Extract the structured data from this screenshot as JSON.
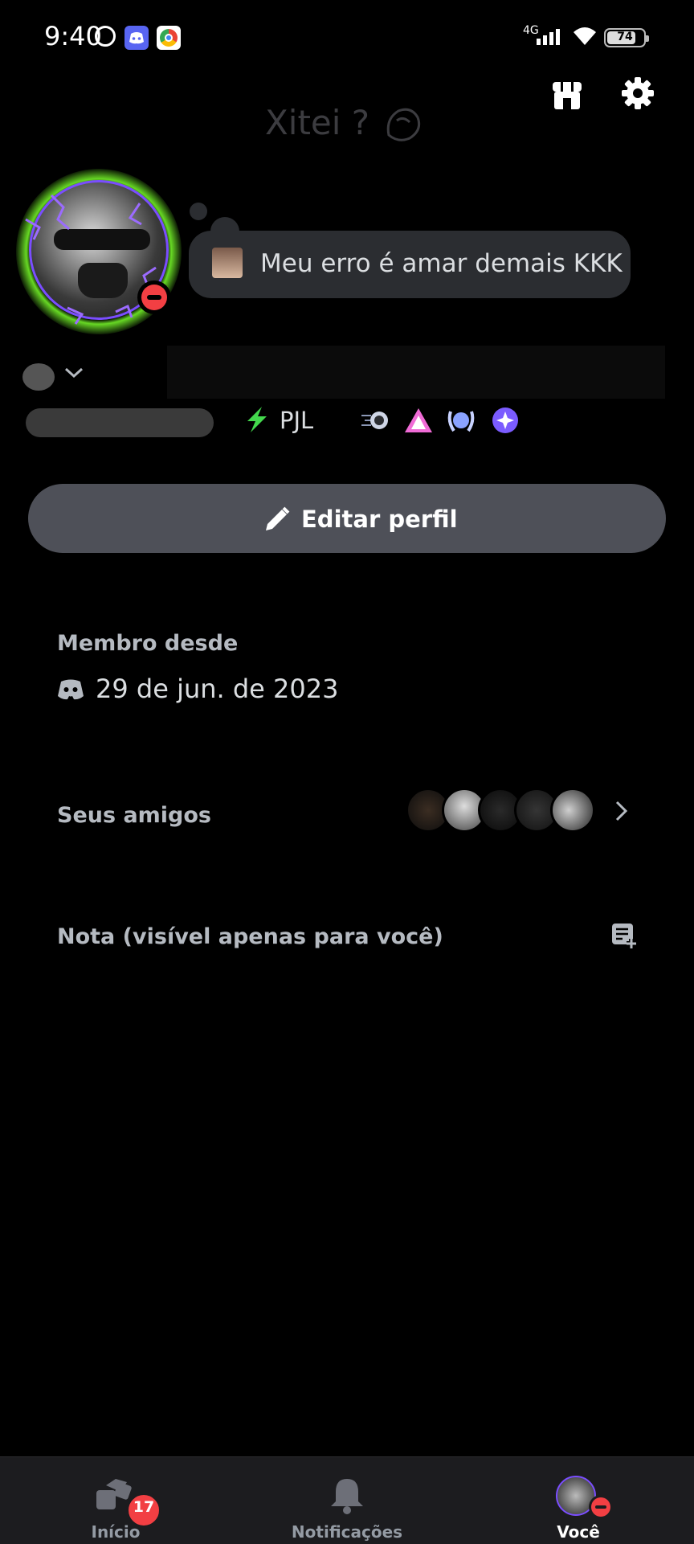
{
  "status_bar": {
    "time": "9:40",
    "network": "4G",
    "battery": "74",
    "icons": [
      "alarm-icon",
      "discord-icon",
      "chrome-icon",
      "signal-icon",
      "wifi-icon",
      "battery-icon"
    ]
  },
  "header": {
    "title": "Xitei ?",
    "icons": [
      "shop-icon",
      "gear-icon"
    ]
  },
  "profile": {
    "status_message": "Meu erro é amar demais KKK",
    "server_tag": "PJL",
    "badges": [
      "speed-badge-icon",
      "triangle-badge-icon",
      "laurel-badge-icon",
      "nitro-badge-icon"
    ],
    "status": "do-not-disturb"
  },
  "actions": {
    "edit_profile": "Editar perfil"
  },
  "info": {
    "member_since_label": "Membro desde",
    "member_since_date": "29 de jun. de 2023",
    "friends_label": "Seus amigos",
    "note_label": "Nota (visível apenas para você)"
  },
  "bottom_nav": {
    "home_label": "Início",
    "home_badge": "17",
    "notifications_label": "Notificações",
    "you_label": "Você"
  },
  "colors": {
    "background": "#000000",
    "button": "#4e5058",
    "dnd_red": "#f23f43",
    "avatar_glow": "#72f028",
    "avatar_ring": "#7a4dff"
  }
}
